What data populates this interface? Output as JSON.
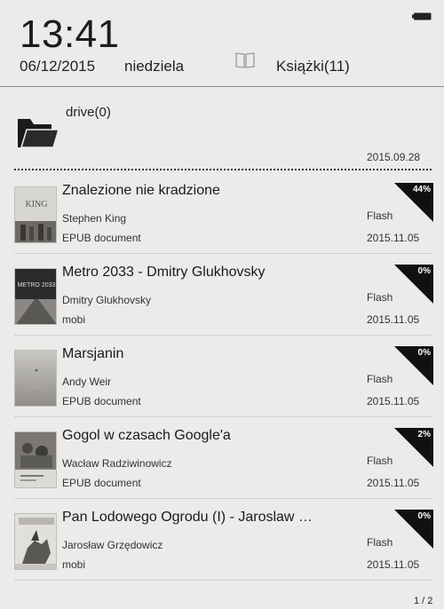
{
  "status": {
    "time": "13:41",
    "date": "06/12/2015",
    "weekday": "niedziela",
    "library_label": "Książki(11)"
  },
  "folder": {
    "name": "drive(0)",
    "date": "2015.09.28"
  },
  "books": [
    {
      "title": "Znalezione nie kradzione",
      "author": "Stephen King",
      "format": "EPUB document",
      "storage": "Flash",
      "date": "2015.11.05",
      "progress": "44%",
      "cover_text": "KING"
    },
    {
      "title": "Metro 2033 - Dmitry Glukhovsky",
      "author": "Dmitry Glukhovsky",
      "format": "mobi",
      "storage": "Flash",
      "date": "2015.11.05",
      "progress": "0%",
      "cover_text": "METRO 2033"
    },
    {
      "title": "Marsjanin",
      "author": "Andy Weir",
      "format": "EPUB document",
      "storage": "Flash",
      "date": "2015.11.05",
      "progress": "0%",
      "cover_text": ""
    },
    {
      "title": "Gogol w czasach Google'a",
      "author": "Wacław Radziwinowicz",
      "format": "EPUB document",
      "storage": "Flash",
      "date": "2015.11.05",
      "progress": "2%",
      "cover_text": ""
    },
    {
      "title": "Pan Lodowego Ogrodu (I) - Jaroslaw …",
      "author": "Jarosław Grzędowicz",
      "format": "mobi",
      "storage": "Flash",
      "date": "2015.11.05",
      "progress": "0%",
      "cover_text": ""
    }
  ],
  "pager": "1 / 2",
  "colors": {
    "background": "#ecebe9",
    "text": "#1a1a1a",
    "progress_badge": "#111111"
  },
  "icons": [
    "battery-icon",
    "book-icon",
    "folder-icon"
  ]
}
